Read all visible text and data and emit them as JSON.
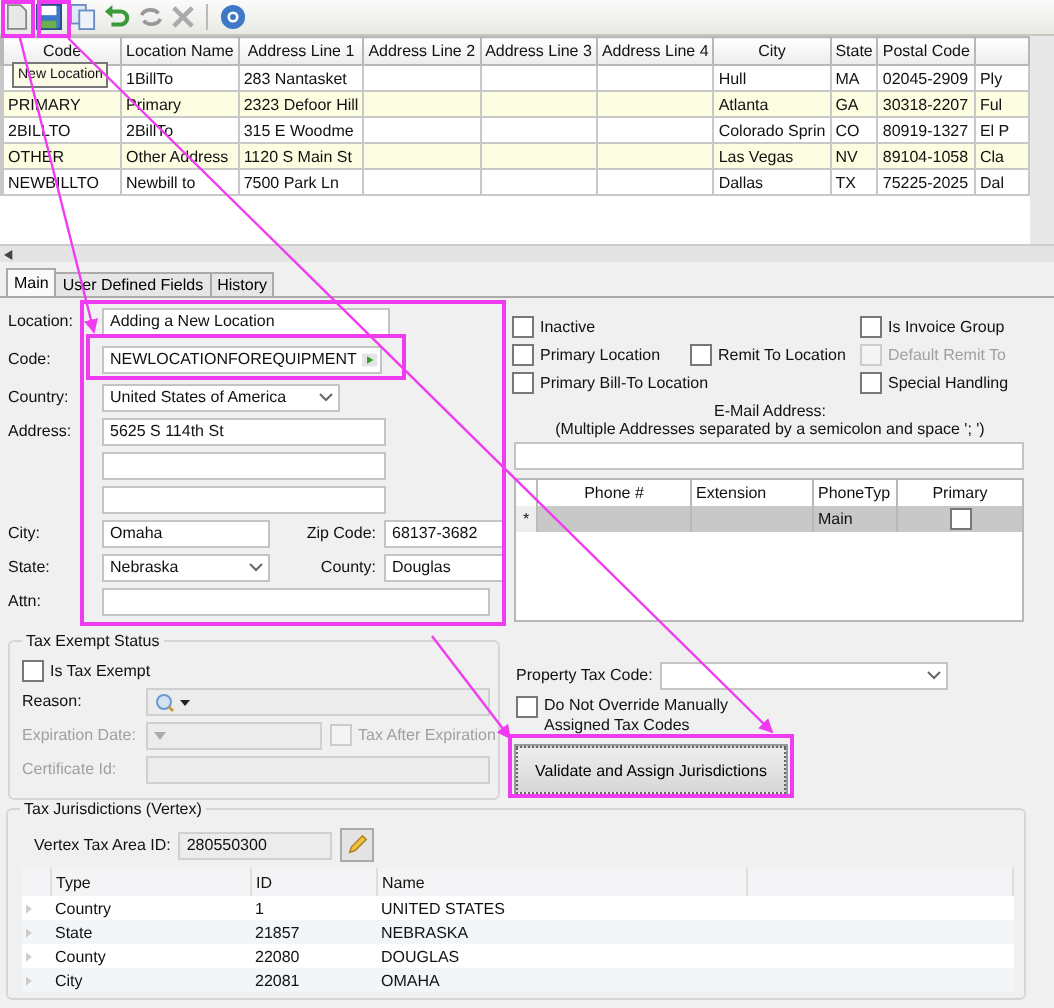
{
  "toolbar": {
    "tooltip": "New Location"
  },
  "locations_table": {
    "columns": [
      "Code",
      "Location Name",
      "Address Line 1",
      "Address Line 2",
      "Address Line 3",
      "Address Line 4",
      "City",
      "State",
      "Postal Code"
    ],
    "rows": [
      {
        "location_name": "1BillTo",
        "address_line_1": "283 Nantasket",
        "city": "Hull",
        "state": "MA",
        "postal_code": "02045-2909",
        "column_10": "Ply"
      },
      {
        "code": "PRIMARY",
        "location_name": "Primary",
        "address_line_1": "2323 Defoor Hill",
        "city": "Atlanta",
        "state": "GA",
        "postal_code": "30318-2207",
        "column_10": "Ful"
      },
      {
        "code": "2BILLTO",
        "location_name": "2BillTo",
        "address_line_1": "315 E Woodme",
        "city": "Colorado Sprin",
        "state": "CO",
        "postal_code": "80919-1327",
        "column_10": "El P"
      },
      {
        "code": "OTHER",
        "location_name": "Other Address",
        "address_line_1": "1120 S Main St",
        "city": "Las Vegas",
        "state": "NV",
        "postal_code": "89104-1058",
        "column_10": "Cla"
      },
      {
        "code": "NEWBILLTO",
        "location_name": "Newbill to",
        "address_line_1": "7500 Park Ln",
        "city": "Dallas",
        "state": "TX",
        "postal_code": "75225-2025",
        "column_10": "Dal"
      }
    ]
  },
  "tabs": [
    {
      "label": "Main",
      "selected": true
    },
    {
      "label": "User Defined Fields",
      "selected": false
    },
    {
      "label": "History",
      "selected": false
    }
  ],
  "form": {
    "location": {
      "label": "Location:",
      "value": "Adding a New Location"
    },
    "code": {
      "label": "Code:",
      "value": "NEWLOCATIONFOREQUIPMENT"
    },
    "country": {
      "label": "Country:",
      "value": "United States of America"
    },
    "address": {
      "label": "Address:",
      "lines": [
        "5625 S 114th St"
      ]
    },
    "city": {
      "label": "City:",
      "value": "Omaha"
    },
    "zip_code": {
      "label": "Zip Code:",
      "value": "68137-3682"
    },
    "state": {
      "label": "State:",
      "value": "Nebraska"
    },
    "county": {
      "label": "County:",
      "value": "Douglas"
    },
    "attn": {
      "label": "Attn:"
    }
  },
  "flags": [
    {
      "label": "Inactive",
      "checked": false,
      "disabled": false
    },
    {
      "label": "Is Invoice Group",
      "checked": false,
      "disabled": false
    },
    {
      "label": "Primary Location",
      "checked": false,
      "disabled": false
    },
    {
      "label": "Remit To Location",
      "checked": false,
      "disabled": false
    },
    {
      "label": "Default Remit To",
      "checked": false,
      "disabled": true
    },
    {
      "label": "Primary Bill-To Location",
      "checked": false,
      "disabled": false
    },
    {
      "label": "Special Handling",
      "checked": false,
      "disabled": false
    }
  ],
  "email": {
    "label": "E-Mail Address:",
    "hint": "(Multiple Addresses separated by a semicolon and space '; ')"
  },
  "phones": {
    "columns": [
      "Phone #",
      "Extension",
      "PhoneTyp",
      "Primary"
    ],
    "new_row_marker": "*",
    "new_row": {
      "phone_type": "Main",
      "primary": false
    }
  },
  "tax_exempt": {
    "title": "Tax Exempt Status",
    "is_tax_exempt": {
      "label": "Is Tax Exempt",
      "checked": false
    },
    "reason_label": "Reason:",
    "expiration_date_label": "Expiration Date:",
    "tax_after_expiration": {
      "label": "Tax After Expiration",
      "checked": false
    },
    "certificate_id_label": "Certificate Id:"
  },
  "property_tax": {
    "label": "Property Tax Code:",
    "do_not_override": {
      "label": "Do Not Override Manually Assigned Tax Codes",
      "checked": false
    },
    "validate_button": "Validate and Assign Jurisdictions"
  },
  "jurisdictions": {
    "title": "Tax Jurisdictions (Vertex)",
    "area_id_label": "Vertex Tax Area ID:",
    "area_id": "280550300",
    "columns": [
      "Type",
      "ID",
      "Name"
    ],
    "rows": [
      {
        "type": "Country",
        "id": "1",
        "name": "UNITED STATES"
      },
      {
        "type": "State",
        "id": "21857",
        "name": "NEBRASKA"
      },
      {
        "type": "County",
        "id": "22080",
        "name": "DOUGLAS"
      },
      {
        "type": "City",
        "id": "22081",
        "name": "OMAHA"
      }
    ]
  }
}
